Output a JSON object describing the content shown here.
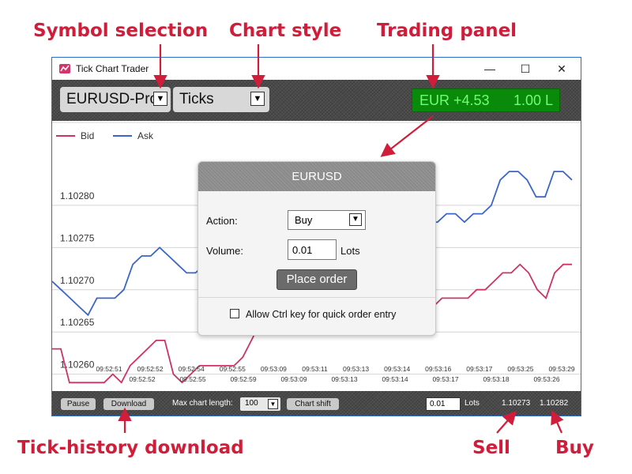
{
  "callouts": {
    "symbol": "Symbol selection",
    "style": "Chart style",
    "trading": "Trading panel",
    "download": "Tick-history download",
    "sell": "Sell",
    "buy": "Buy"
  },
  "window": {
    "title": "Tick Chart Trader",
    "minimize": "—",
    "maximize": "☐",
    "close": "✕"
  },
  "toolbar": {
    "symbol": "EURUSD-Pro",
    "chart_style": "Ticks",
    "trade_profit": "EUR +4.53",
    "trade_lots": "1.00 L"
  },
  "legend": {
    "bid": "Bid",
    "ask": "Ask"
  },
  "dialog": {
    "title": "EURUSD",
    "action_label": "Action:",
    "action_value": "Buy",
    "volume_label": "Volume:",
    "volume_value": "0.01",
    "lots_label": "Lots",
    "place_order": "Place order",
    "ctrl_option": "Allow Ctrl key for quick order entry"
  },
  "statusbar": {
    "pause": "Pause",
    "download": "Download",
    "max_length_label": "Max chart length:",
    "max_length_value": "100",
    "chart_shift": "Chart shift",
    "lots_value": "0.01",
    "lots_label": "Lots",
    "sell_price": "1.10273",
    "buy_price": "1.10282"
  },
  "colors": {
    "bid": "#cc3366",
    "ask": "#3a66c8",
    "trade_panel": "#0a8a0a",
    "callout": "#cf1d3a"
  },
  "chart_data": {
    "type": "line",
    "ylim": [
      1.10258,
      1.1029
    ],
    "y_ticks": [
      "1.10260",
      "1.10265",
      "1.10270",
      "1.10275",
      "1.10280"
    ],
    "x_ticks_upper": [
      "09:52:51",
      "09:52:52",
      "09:52:54",
      "09:52:55",
      "09:53:09",
      "09:53:11",
      "09:53:13",
      "09:53:14",
      "09:53:16",
      "09:53:17",
      "09:53:25",
      "09:53:29"
    ],
    "x_ticks_lower": [
      "09:52:52",
      "09:52:55",
      "09:52:59",
      "09:53:09",
      "09:53:13",
      "09:53:14",
      "09:53:17",
      "09:53:18",
      "09:53:26"
    ],
    "series": [
      {
        "name": "Bid",
        "color": "#cc3366",
        "values": [
          1.10263,
          1.10263,
          1.10259,
          1.10259,
          1.10259,
          1.10259,
          1.10259,
          1.1026,
          1.10259,
          1.10261,
          1.10262,
          1.10263,
          1.10264,
          1.10264,
          1.1026,
          1.10259,
          1.1026,
          1.10261,
          1.10261,
          1.10261,
          1.10261,
          1.10261,
          1.10262,
          1.10264,
          1.10266,
          1.10268,
          1.10269,
          1.10269,
          1.10268,
          1.10268,
          1.10268,
          1.10268,
          1.10267,
          1.10268,
          1.10268,
          1.10267,
          1.10267,
          1.10267,
          1.10267,
          1.10266,
          1.10266,
          1.10266,
          1.10266,
          1.10268,
          1.10268,
          1.10269,
          1.10269,
          1.10269,
          1.10269,
          1.1027,
          1.1027,
          1.10271,
          1.10272,
          1.10272,
          1.10273,
          1.10272,
          1.1027,
          1.10269,
          1.10272,
          1.10273,
          1.10273
        ]
      },
      {
        "name": "Ask",
        "color": "#3a66c8",
        "values": [
          1.10271,
          1.1027,
          1.10269,
          1.10268,
          1.10267,
          1.10269,
          1.10269,
          1.10269,
          1.1027,
          1.10273,
          1.10274,
          1.10274,
          1.10275,
          1.10274,
          1.10273,
          1.10272,
          1.10272,
          1.10273,
          1.10274,
          1.10275,
          1.10276,
          1.10276,
          1.10277,
          1.10277,
          1.10278,
          1.10278,
          1.10279,
          1.10279,
          1.1028,
          1.10279,
          1.10279,
          1.10279,
          1.10279,
          1.10279,
          1.1028,
          1.1028,
          1.1028,
          1.1028,
          1.1028,
          1.1028,
          1.1028,
          1.1028,
          1.10278,
          1.10278,
          1.10279,
          1.10279,
          1.10278,
          1.10279,
          1.10279,
          1.1028,
          1.10283,
          1.10284,
          1.10284,
          1.10283,
          1.10281,
          1.10281,
          1.10284,
          1.10284,
          1.10283
        ]
      }
    ]
  }
}
